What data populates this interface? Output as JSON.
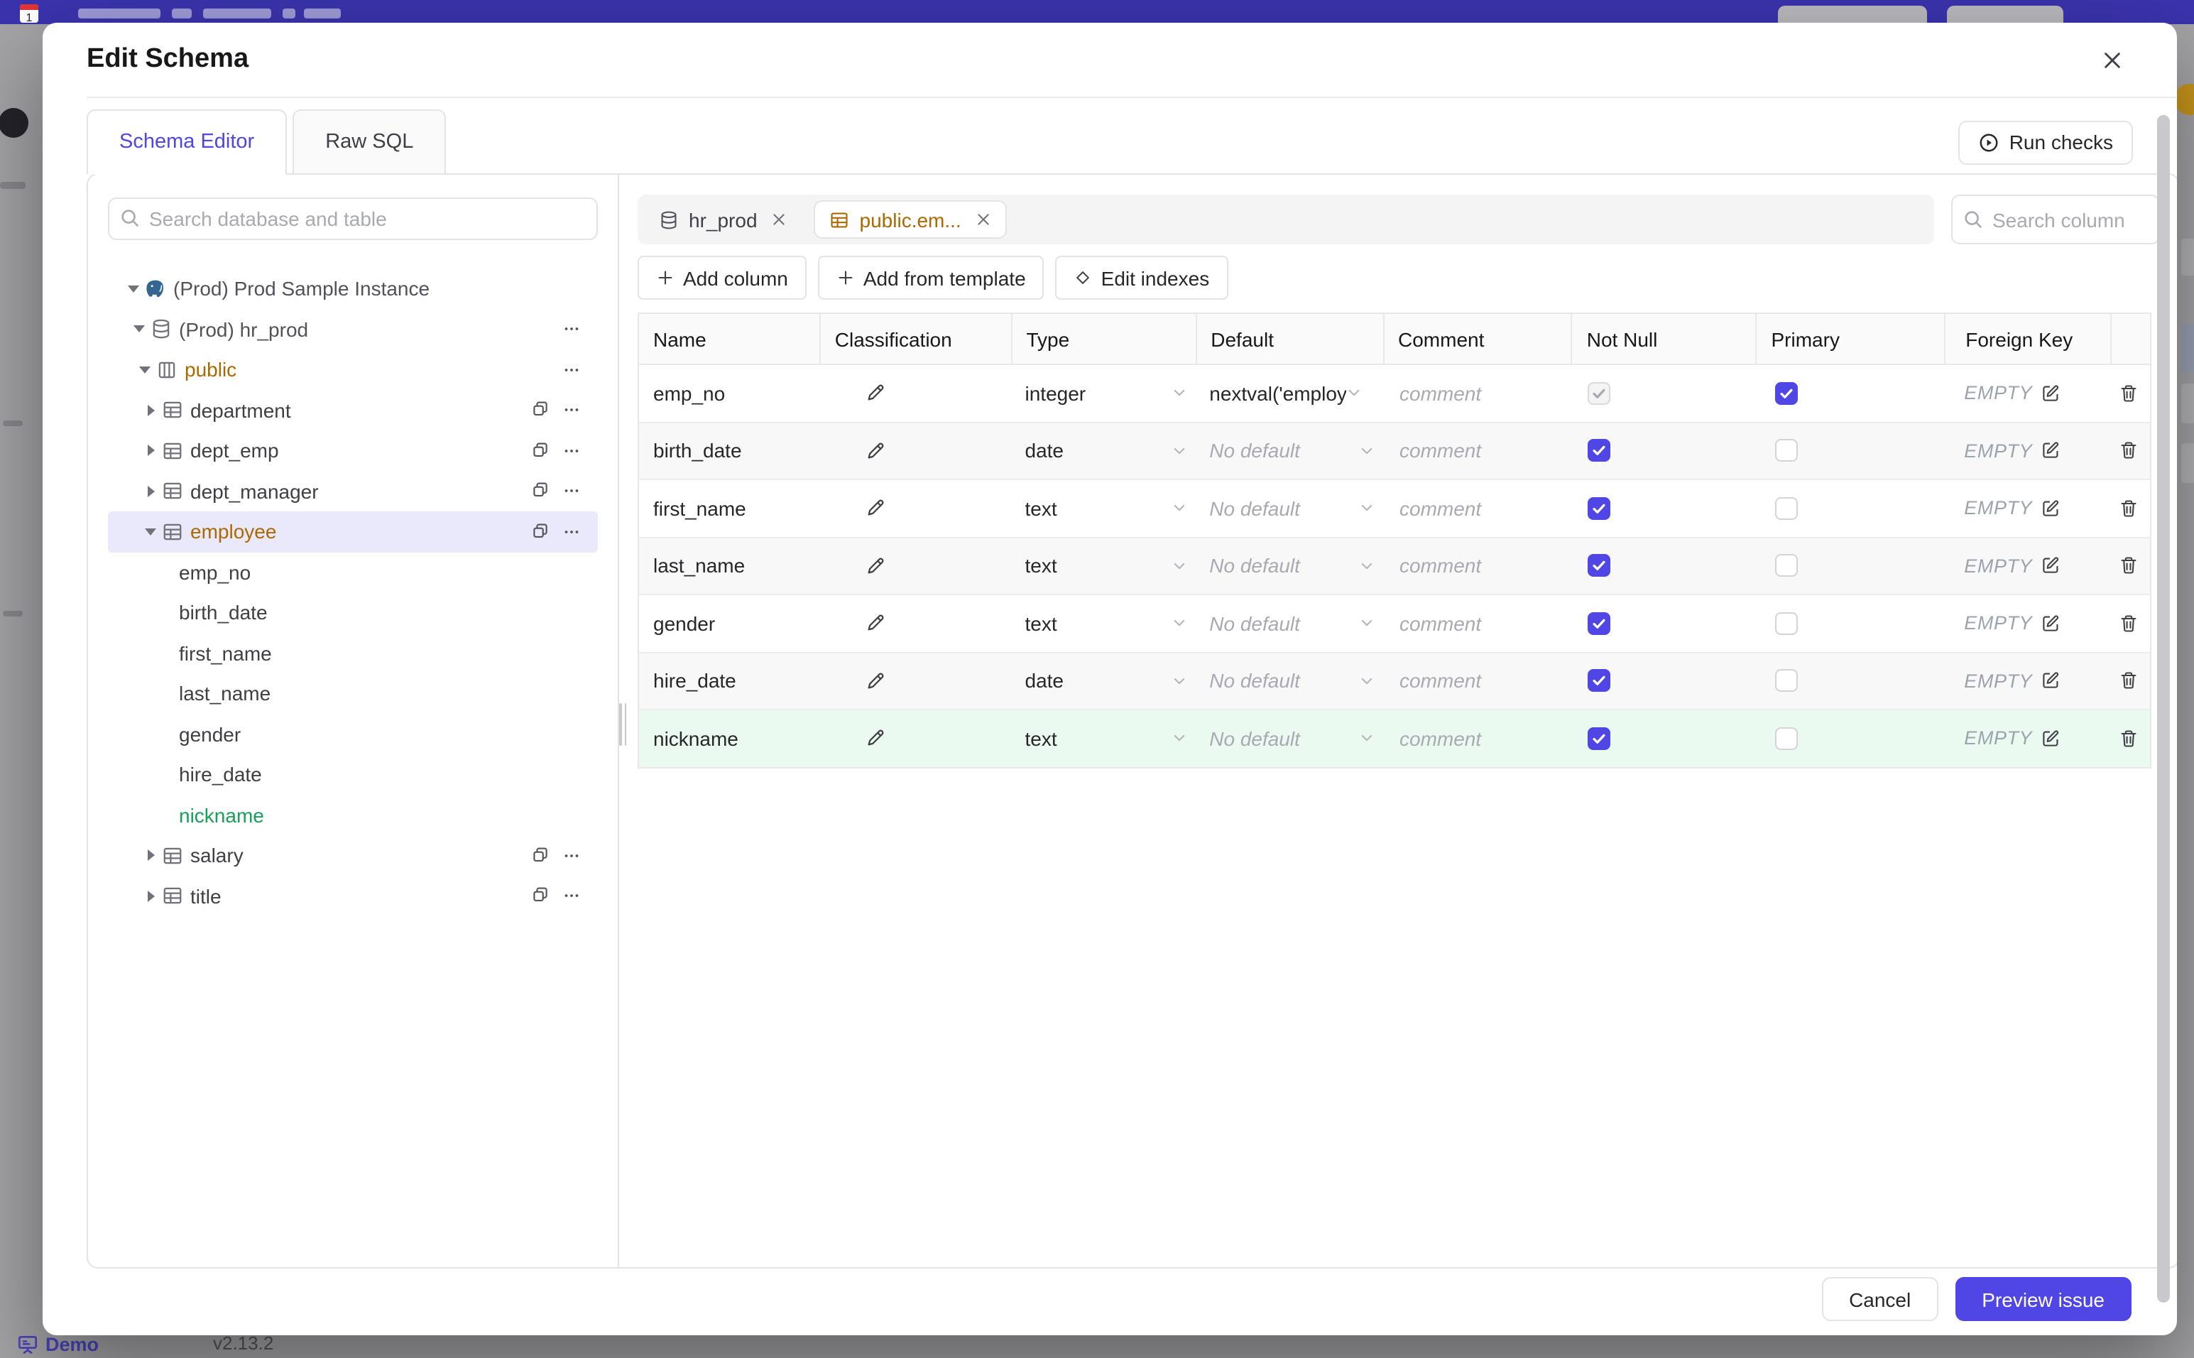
{
  "background": {
    "workspace_label": "Demo",
    "version": "v2.13.2"
  },
  "modal": {
    "title": "Edit Schema",
    "tabs": [
      {
        "label": "Schema Editor",
        "active": true
      },
      {
        "label": "Raw SQL",
        "active": false
      }
    ],
    "run_checks": {
      "label": "Run checks",
      "icon": "play-circle"
    },
    "sidebar": {
      "search": {
        "placeholder": "Search database and table",
        "icon": "magnifier"
      },
      "tree": [
        {
          "kind": "instance",
          "level": 1,
          "expanded": true,
          "icon": "postgresql",
          "label": "(Prod) Prod Sample Instance",
          "muted": true
        },
        {
          "kind": "database",
          "level": 2,
          "expanded": true,
          "icon": "database",
          "label": "(Prod) hr_prod",
          "muted": true,
          "actions": [
            "more"
          ]
        },
        {
          "kind": "schema",
          "level": 3,
          "expanded": true,
          "icon": "schema",
          "label": "public",
          "state": "modified",
          "actions": [
            "more"
          ]
        },
        {
          "kind": "table",
          "level": 4,
          "expanded": false,
          "icon": "table",
          "label": "department",
          "actions": [
            "copy",
            "more"
          ]
        },
        {
          "kind": "table",
          "level": 4,
          "expanded": false,
          "icon": "table",
          "label": "dept_emp",
          "actions": [
            "copy",
            "more"
          ]
        },
        {
          "kind": "table",
          "level": 4,
          "expanded": false,
          "icon": "table",
          "label": "dept_manager",
          "actions": [
            "copy",
            "more"
          ]
        },
        {
          "kind": "table",
          "level": 4,
          "expanded": true,
          "icon": "table",
          "label": "employee",
          "state": "modified",
          "selected": true,
          "actions": [
            "copy",
            "more"
          ]
        },
        {
          "kind": "column",
          "level": 5,
          "label": "emp_no"
        },
        {
          "kind": "column",
          "level": 5,
          "label": "birth_date"
        },
        {
          "kind": "column",
          "level": 5,
          "label": "first_name"
        },
        {
          "kind": "column",
          "level": 5,
          "label": "last_name"
        },
        {
          "kind": "column",
          "level": 5,
          "label": "gender"
        },
        {
          "kind": "column",
          "level": 5,
          "label": "hire_date"
        },
        {
          "kind": "column",
          "level": 5,
          "label": "nickname",
          "state": "created"
        },
        {
          "kind": "table",
          "level": 4,
          "expanded": false,
          "icon": "table",
          "label": "salary",
          "actions": [
            "copy",
            "more"
          ]
        },
        {
          "kind": "table",
          "level": 4,
          "expanded": false,
          "icon": "table",
          "label": "title",
          "actions": [
            "copy",
            "more"
          ]
        }
      ]
    },
    "editor": {
      "open_tabs": [
        {
          "label": "hr_prod",
          "icon": "database",
          "active": false
        },
        {
          "label": "public.em...",
          "icon": "table",
          "active": true,
          "state": "modified"
        }
      ],
      "column_search": {
        "placeholder": "Search column",
        "icon": "magnifier"
      },
      "toolbar": [
        {
          "label": "Add column",
          "icon": "plus"
        },
        {
          "label": "Add from template",
          "icon": "plus"
        },
        {
          "label": "Edit indexes",
          "icon": "diamond"
        }
      ],
      "grid": {
        "headers": [
          "Name",
          "Classification",
          "Type",
          "Default",
          "Comment",
          "Not Null",
          "Primary",
          "Foreign Key"
        ],
        "comment_placeholder": "comment",
        "foreign_key_empty": "EMPTY",
        "rows": [
          {
            "name": "emp_no",
            "type": "integer",
            "default": "nextval('employ",
            "default_placeholder": false,
            "not_null": true,
            "not_null_disabled": true,
            "primary": true
          },
          {
            "name": "birth_date",
            "type": "date",
            "default": "No default",
            "default_placeholder": true,
            "not_null": true,
            "primary": false
          },
          {
            "name": "first_name",
            "type": "text",
            "default": "No default",
            "default_placeholder": true,
            "not_null": true,
            "primary": false
          },
          {
            "name": "last_name",
            "type": "text",
            "default": "No default",
            "default_placeholder": true,
            "not_null": true,
            "primary": false
          },
          {
            "name": "gender",
            "type": "text",
            "default": "No default",
            "default_placeholder": true,
            "not_null": true,
            "primary": false
          },
          {
            "name": "hire_date",
            "type": "date",
            "default": "No default",
            "default_placeholder": true,
            "not_null": true,
            "primary": false
          },
          {
            "name": "nickname",
            "type": "text",
            "default": "No default",
            "default_placeholder": true,
            "not_null": true,
            "primary": false,
            "state": "created"
          }
        ]
      }
    },
    "footer": {
      "cancel_label": "Cancel",
      "submit_label": "Preview issue"
    }
  },
  "colors": {
    "accent": "#4f46e5",
    "modified_text": "#ad6800",
    "created_text": "#18a058",
    "created_row_bg": "#eafaf0",
    "topbar": "#3b33ad"
  }
}
